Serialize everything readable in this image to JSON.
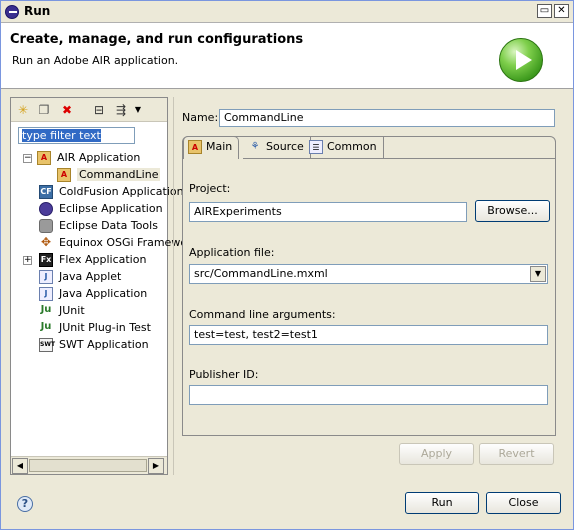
{
  "window": {
    "title": "Run"
  },
  "header": {
    "title": "Create, manage, and run configurations",
    "message": "Run an Adobe AIR application."
  },
  "filter": {
    "value": "type filter text"
  },
  "tree": {
    "items": [
      {
        "label": "AIR Application"
      },
      {
        "label": "CommandLine"
      },
      {
        "label": "ColdFusion Application"
      },
      {
        "label": "Eclipse Application"
      },
      {
        "label": "Eclipse Data Tools"
      },
      {
        "label": "Equinox OSGi Framework"
      },
      {
        "label": "Flex Application"
      },
      {
        "label": "Java Applet"
      },
      {
        "label": "Java Application"
      },
      {
        "label": "JUnit"
      },
      {
        "label": "JUnit Plug-in Test"
      },
      {
        "label": "SWT Application"
      }
    ]
  },
  "name": {
    "label": "Name:",
    "value": "CommandLine"
  },
  "tabs": [
    {
      "label": "Main"
    },
    {
      "label": "Source"
    },
    {
      "label": "Common"
    }
  ],
  "main": {
    "project_label": "Project:",
    "project_value": "AIRExperiments",
    "browse_label": "Browse...",
    "app_file_label": "Application file:",
    "app_file_value": "src/CommandLine.mxml",
    "args_label": "Command line arguments:",
    "args_value": "test=test, test2=test1",
    "publisher_label": "Publisher ID:",
    "publisher_value": ""
  },
  "buttons": {
    "apply": "Apply",
    "revert": "Revert",
    "run": "Run",
    "close": "Close"
  }
}
